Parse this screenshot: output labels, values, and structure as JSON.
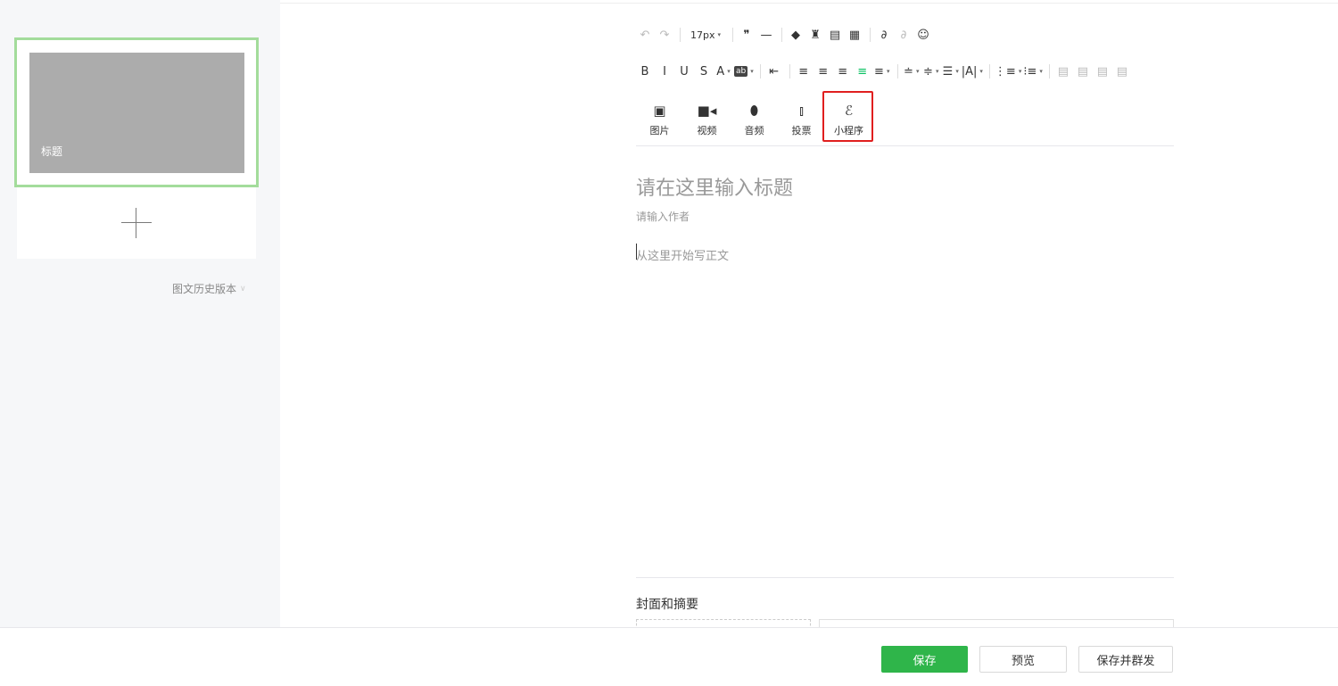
{
  "sidebar": {
    "article_title": "标题",
    "history_label": "图文历史版本"
  },
  "toolbar": {
    "row1": [
      {
        "name": "undo-icon",
        "glyph": "↶",
        "dim": true
      },
      {
        "name": "redo-icon",
        "glyph": "↷",
        "dim": true
      },
      {
        "sep": true
      },
      {
        "name": "font-size-select",
        "text": "17px",
        "caret": true
      },
      {
        "sep": true
      },
      {
        "name": "quote-icon",
        "glyph": "❞"
      },
      {
        "name": "horizontal-rule-icon",
        "glyph": "—"
      },
      {
        "sep": true
      },
      {
        "name": "eraser-icon",
        "glyph": "◆"
      },
      {
        "name": "format-painter-icon",
        "glyph": "♜"
      },
      {
        "name": "insert-template-icon",
        "glyph": "▤"
      },
      {
        "name": "document-icon",
        "glyph": "▦"
      },
      {
        "sep": true
      },
      {
        "name": "link-icon",
        "glyph": "∂"
      },
      {
        "name": "unlink-icon",
        "glyph": "∂",
        "dim": true
      },
      {
        "name": "emoji-icon",
        "glyph": "☺"
      }
    ],
    "row2": [
      {
        "name": "bold-icon",
        "glyph": "B"
      },
      {
        "name": "italic-icon",
        "glyph": "I"
      },
      {
        "name": "underline-icon",
        "glyph": "U"
      },
      {
        "name": "strikethrough-icon",
        "glyph": "S"
      },
      {
        "name": "font-color-icon",
        "glyph": "A",
        "caret": true
      },
      {
        "name": "highlight-color-icon",
        "glyph": "ab",
        "box": true,
        "caret": true
      },
      {
        "sep": true
      },
      {
        "name": "indent-icon",
        "glyph": "⇤"
      },
      {
        "sep": true
      },
      {
        "name": "align-left-icon",
        "glyph": "≡"
      },
      {
        "name": "align-center-icon",
        "glyph": "≡"
      },
      {
        "name": "align-right-icon",
        "glyph": "≡"
      },
      {
        "name": "align-justify-icon",
        "glyph": "≡",
        "green": true
      },
      {
        "name": "align-distribute-icon",
        "glyph": "≡",
        "caret": true
      },
      {
        "sep": true
      },
      {
        "name": "paragraph-before-icon",
        "glyph": "≐",
        "caret": true
      },
      {
        "name": "paragraph-after-icon",
        "glyph": "≑",
        "caret": true
      },
      {
        "name": "line-height-icon",
        "glyph": "☰",
        "caret": true
      },
      {
        "name": "letter-spacing-icon",
        "glyph": "|A|",
        "caret": true
      },
      {
        "sep": true
      },
      {
        "name": "ordered-list-icon",
        "glyph": "⋮≡",
        "caret": true
      },
      {
        "name": "unordered-list-icon",
        "glyph": "⁝≡",
        "caret": true
      },
      {
        "sep": true
      },
      {
        "name": "image-float-left-icon",
        "glyph": "▤",
        "dim": true
      },
      {
        "name": "image-float-right-icon",
        "glyph": "▤",
        "dim": true
      },
      {
        "name": "image-float-none-icon",
        "glyph": "▤",
        "dim": true
      },
      {
        "name": "image-center-icon",
        "glyph": "▤",
        "dim": true
      }
    ]
  },
  "media": [
    {
      "name": "insert-image-button",
      "icon": "image-icon",
      "glyph": "▣",
      "label": "图片"
    },
    {
      "name": "insert-video-button",
      "icon": "video-icon",
      "glyph": "■◂",
      "label": "视频"
    },
    {
      "name": "insert-audio-button",
      "icon": "microphone-icon",
      "glyph": "⬮",
      "label": "音频"
    },
    {
      "name": "insert-vote-button",
      "icon": "bar-chart-icon",
      "glyph": "⫾",
      "label": "投票"
    },
    {
      "name": "insert-mini-program-button",
      "icon": "mini-program-icon",
      "glyph": "ℰ",
      "label": "小程序"
    }
  ],
  "editor": {
    "title_placeholder": "请在这里输入标题",
    "author_placeholder": "请输入作者",
    "body_placeholder": "从这里开始写正文"
  },
  "cover": {
    "section_title": "封面和摘要"
  },
  "footer": {
    "save_label": "保存",
    "preview_label": "预览",
    "publish_label": "保存并群发"
  },
  "colors": {
    "accent_green": "#2fb54a",
    "selected_border": "#a3dc9b",
    "highlight_red": "#e01f1f"
  }
}
